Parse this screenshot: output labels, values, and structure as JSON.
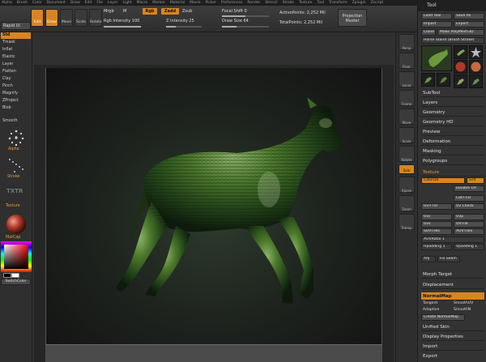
{
  "menu": [
    "Alpha",
    "Brush",
    "Color",
    "Document",
    "Draw",
    "Edit",
    "File",
    "Layer",
    "Light",
    "Macro",
    "Marker",
    "Material",
    "Movie",
    "Picker",
    "Preferences",
    "Render",
    "Stencil",
    "Stroke",
    "Texture",
    "Tool",
    "Transform",
    "Zplugin",
    "Zscript"
  ],
  "topbar": {
    "edit_label": "Edit",
    "draw_label": "Draw",
    "move_label": "Move",
    "scale_label": "Scale",
    "rotate_label": "Rotate",
    "mrgb_label": "Mrgb",
    "rgb_label": "Rgb",
    "m_label": "M",
    "zadd_label": "Zadd",
    "zsub_label": "Zsub",
    "focal_shift": "Focal Shift 0",
    "draw_size": "Draw Size 64",
    "rgb_intensity": "Rgb Intensity 100",
    "z_intensity": "Z Intensity 25",
    "active_points": "ActivePoints: 2,252 Mil",
    "total_points": "TotalPoints: 2,252 Mil",
    "projection_master": "Projection Master"
  },
  "left": {
    "rapid_label": "Rapid Ul",
    "brushes": [
      "Std",
      "Tmask",
      "Inflat",
      "Elastic",
      "Layer",
      "Flatten",
      "Clay",
      "Pinch",
      "Magnify",
      "ZProject",
      "Blob",
      "Smooth"
    ],
    "alpha_label": "Alpha",
    "stroke_label": "Stroke",
    "texture_label": "Texture",
    "txtr_label": "TXTR",
    "material_label": "MatCap",
    "switch_color": "SwitchColor"
  },
  "rightbar": [
    "Persp",
    "Floor",
    "Local",
    "Frame",
    "Move",
    "Scale",
    "Rotate",
    "Solo",
    "Xpose",
    "Zoom",
    "Actual",
    "AAHalf",
    "Transp",
    "Ghost",
    "Lasso"
  ],
  "tray": {
    "title": "Tool",
    "load_tool": "Load Tool",
    "save_as": "Save As",
    "import": "Import",
    "export": "Export",
    "clone": "Clone",
    "make_polymesh": "Make PolyMesh3D",
    "tool_name": "Horse Stand (Brush Stroke)",
    "sections": [
      "SubTool",
      "Layers",
      "Geometry",
      "Geometry HD",
      "Preview",
      "Deformation",
      "Masking",
      "Polygroups"
    ],
    "texture_header": "Texture",
    "colorize": "Colorize",
    "grd": "Grd",
    "disable_uv": "Disable UV",
    "col_txr": "Col>Txr",
    "uv_txr": "Uv>Txr",
    "uv_check": "Uv Check",
    "uvc": "Uvc",
    "uvp": "Uvp",
    "uvs": "Uvs",
    "uvtile": "UVTile",
    "suvtiles": "SUVTiles",
    "auvtiles": "AUVTiles",
    "auvratio": "AUVRatio 1",
    "hpadding": "Hpadding 1",
    "vpadding": "Vpadding 1",
    "adj": "Adj",
    "fix_seam": "Fix Seam",
    "morph_target": "Morph Target",
    "displacement": "Displacement",
    "normalmap": "NormalMap",
    "tangent": "Tangent",
    "smooth_uv": "SmoothUV",
    "adaptive": "Adaptive",
    "smooth_n": "SmoothN",
    "create_normalmap": "Create NormalMap",
    "unified_skin": "Unified Skin",
    "display_properties": "Display Properties",
    "import2": "Import",
    "export2": "Export"
  }
}
